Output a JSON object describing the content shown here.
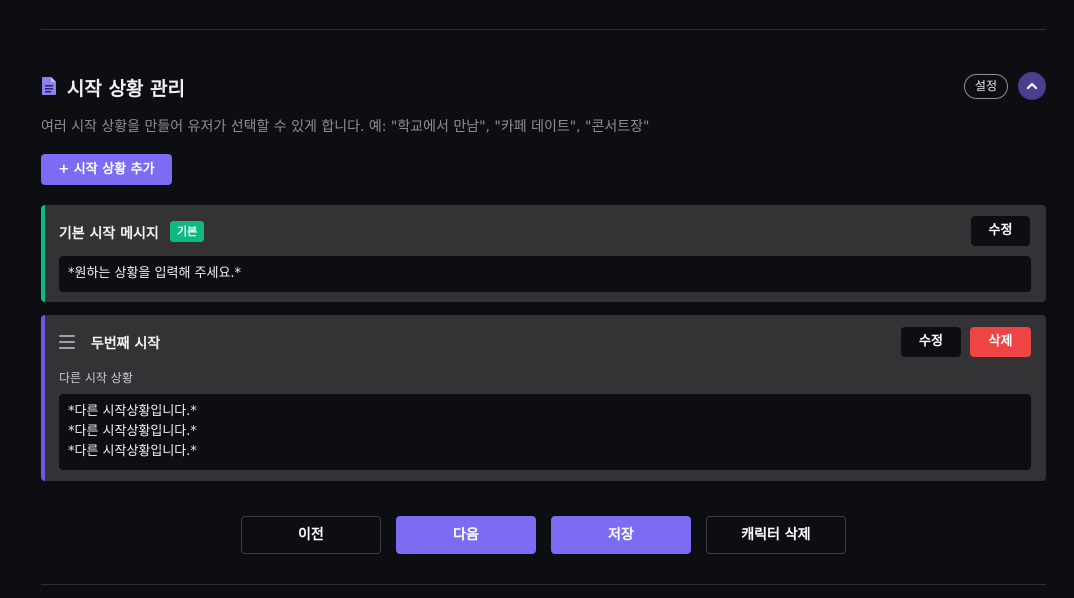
{
  "header": {
    "title": "시작 상황 관리",
    "settings_label": "설정",
    "description": "여러 시작 상황을 만들어 유저가 선택할 수 있게 합니다. 예: \"학교에서 만남\", \"카페 데이트\", \"콘서트장\""
  },
  "add_button_label": "+ 시작 상황 추가",
  "default_card": {
    "title": "기본 시작 메시지",
    "badge": "기본",
    "edit_label": "수정",
    "message": "*원하는 상황을 입력해 주세요.*"
  },
  "second_card": {
    "title": "두번째 시작",
    "edit_label": "수정",
    "delete_label": "삭제",
    "subtitle": "다른 시작 상황",
    "lines": [
      "*다른 시작상황입니다.*",
      "*다른 시작상황입니다.*",
      "*다른 시작상황입니다.*"
    ]
  },
  "footer": {
    "prev_label": "이전",
    "next_label": "다음",
    "save_label": "저장",
    "delete_character_label": "캐릭터 삭제"
  },
  "colors": {
    "accent": "#7c6cf4",
    "success": "#10b981",
    "danger": "#ef4444",
    "background": "#0c0e12",
    "card": "#333336"
  },
  "icons": [
    "document-icon",
    "chevron-up-icon",
    "drag-handle-icon"
  ]
}
